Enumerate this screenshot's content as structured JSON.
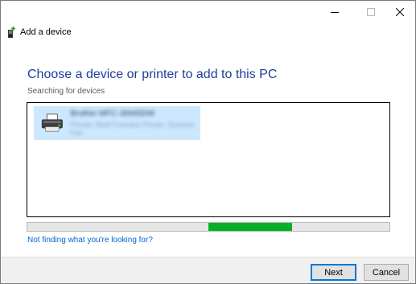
{
  "window": {
    "title": "Add a device",
    "controls": [
      "minimize-icon",
      "maximize-icon",
      "close-icon"
    ]
  },
  "main": {
    "heading": "Choose a device or printer to add to this PC",
    "status": "Searching for devices",
    "devices": [
      {
        "name": "Brother MFC-J6945DW",
        "subtitle": "Printer, Multi Function Printer, Scanner, Fax",
        "icon": "printer-icon",
        "selected": true
      }
    ],
    "progress": 0.65,
    "help_link": "Not finding what you're looking for?"
  },
  "footer": {
    "next_label": "Next",
    "cancel_label": "Cancel"
  },
  "colors": {
    "heading": "#1f3d99",
    "link": "#0066cc",
    "progress_fill": "#06b025",
    "selection": "#cce8ff",
    "default_button_border": "#0078d7"
  }
}
